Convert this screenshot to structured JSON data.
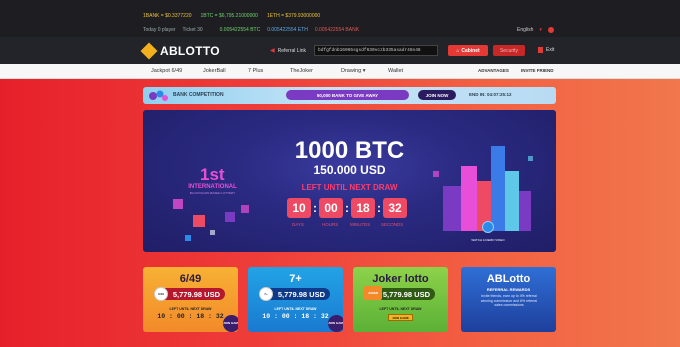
{
  "topbar": {
    "rates": [
      {
        "text": "1BANK = $0.3377220",
        "color": "#e8c33a"
      },
      {
        "text": "1BTC = $6,795.21000000",
        "color": "#6dd36d"
      },
      {
        "text": "1ETH = $379.93000000",
        "color": "#e8c33a"
      }
    ],
    "today_players": "Today 0 player",
    "ticket": "Ticket 30",
    "balances": [
      "0.005422554 BTC",
      "0.005422554 ETH",
      "0.005422554 BANK"
    ],
    "language": "English"
  },
  "header": {
    "logo": "ABLOTTO",
    "referral_label": "Referral Link",
    "referral_value": "bdfgfdnb16065sgsdf630vczb335asadr46n46",
    "cabinet": "Cabinet",
    "security": "Security",
    "exit": "Exit"
  },
  "nav": {
    "items": [
      "Jackpot 6/49",
      "JokerBall",
      "7 Plus",
      "TheJoker",
      "Drawing",
      "Wallet"
    ],
    "advantages": "ADVANTAGES",
    "invite": "INVITE FRIEND"
  },
  "banner": {
    "title": "BANK COMPETITION",
    "pill": "50,000 BANK TO GIVE AWAY",
    "button": "JOIN NOW",
    "end": "END IN: 04:07:25:12"
  },
  "hero": {
    "rank": "1st",
    "international": "INTERNATIONAL",
    "subtitle": "BLOCKCHAIN-BASED LOTTERY",
    "amount": "1000 BTC",
    "usd": "150.000 USD",
    "left_until": "LEFT UNTIL NEXT DRAW",
    "timer": {
      "days": "10",
      "hours": "00",
      "minutes": "18",
      "seconds": "32"
    },
    "timer_labels": {
      "days": "DAYS",
      "hours": "HOURS",
      "minutes": "MINUTES",
      "seconds": "SECONDS"
    },
    "watch": "WATCH A DEMO VIDEO"
  },
  "cards": [
    {
      "title": "6/49",
      "ball": "6/49",
      "amount": "5,779.98 USD",
      "left": "LEFT UNTIL NEXT DRAW",
      "time": "10 : 00 : 18 : 32",
      "join": "JOIN GAME"
    },
    {
      "title": "7+",
      "ball": "7+",
      "amount": "5,779.98 USD",
      "left": "LEFT UNTIL NEXT DRAW",
      "time": "10 : 00 : 18 : 32",
      "join": "JOIN GAME"
    },
    {
      "title": "Joker lotto",
      "ball": "JOKER",
      "amount": "5,779.98 USD",
      "left": "LEFT UNTIL NEXT DRAW",
      "button": "JOIN GAME"
    },
    {
      "title": "ABLotto",
      "sub": "REFERRAL REWARDS",
      "desc": "Invite friends, earn up to 4% referral winning commission and 6% referral sales commissions"
    }
  ],
  "colors": {
    "accent": "#e53935",
    "main_bg_start": "#e6202a",
    "main_bg_end": "#f1774c",
    "hero_bg": "#2a2a82",
    "timer_box": "#ef4a63"
  }
}
